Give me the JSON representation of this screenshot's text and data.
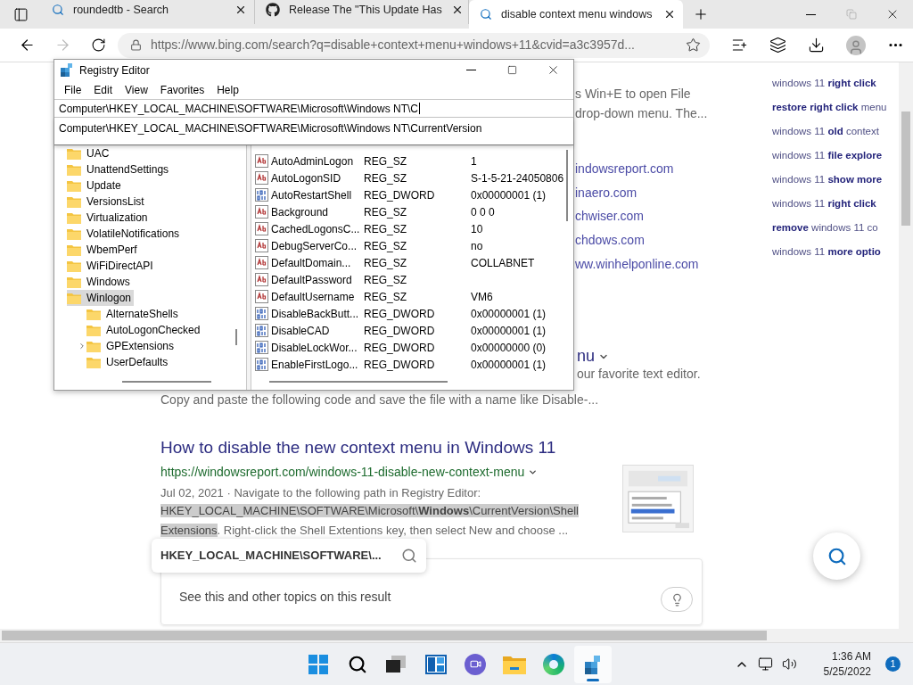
{
  "browser": {
    "tabs": [
      {
        "kind": "search",
        "title": "roundedtb - Search",
        "selected": false
      },
      {
        "kind": "github",
        "title": "Release The \"This Update Has",
        "selected": false
      },
      {
        "kind": "search",
        "title": "disable context menu windows",
        "selected": true
      }
    ],
    "address": "https://www.bing.com/search?q=disable+context+menu+windows+11&cvid=a3c3957d..."
  },
  "page": {
    "behind_window": {
      "snippet_lines": [
        "s Win+E to open File",
        "drop-down menu. The..."
      ],
      "sites": [
        "indowsreport.com",
        "inaero.com",
        "chwiser.com",
        "chdows.com",
        "ww.winhelponline.com"
      ],
      "title_end": "nu",
      "snippet_end": "our favorite text editor."
    },
    "copy_line": "Copy and paste the following code and save the file with a name like Disable-...",
    "result": {
      "title": "How to disable the new context menu in Windows 11",
      "url": "https://windowsreport.com/windows-11-disable-new-context-menu",
      "date": "Jul 02, 2021 · Navigate to the following path in Registry Editor:",
      "highlight_1": "HKEY_LOCAL_MACHINE\\SOFTWARE\\Microsoft\\**Windows**\\CurrentVersion\\Shell",
      "highlight_2": "Extensions",
      "rest": ". Right-click the Shell Extentions key, then select New and choose ..."
    },
    "floating_search": "HKEY_LOCAL_MACHINE\\SOFTWARE\\...",
    "topics": "See this and other topics on this result",
    "related": [
      "windows 11 **right click**",
      "**restore right click** menu",
      "windows 11 **old** context",
      "windows 11 **file explore**",
      "windows 11 **show more**",
      "windows 11 **right click**",
      "**remove** windows 11 co",
      "windows 11 **more optio**"
    ]
  },
  "registry": {
    "title": "Registry Editor",
    "menu": [
      "File",
      "Edit",
      "View",
      "Favorites",
      "Help"
    ],
    "address": "Computer\\HKEY_LOCAL_MACHINE\\SOFTWARE\\Microsoft\\Windows NT\\C",
    "suggestion": "Computer\\HKEY_LOCAL_MACHINE\\SOFTWARE\\Microsoft\\Windows NT\\CurrentVersion",
    "tree": [
      {
        "label": "UAC",
        "selected": false,
        "expandable": false
      },
      {
        "label": "UnattendSettings",
        "selected": false,
        "expandable": false
      },
      {
        "label": "Update",
        "selected": false,
        "expandable": false
      },
      {
        "label": "VersionsList",
        "selected": false,
        "expandable": false
      },
      {
        "label": "Virtualization",
        "selected": false,
        "expandable": false
      },
      {
        "label": "VolatileNotifications",
        "selected": false,
        "expandable": false
      },
      {
        "label": "WbemPerf",
        "selected": false,
        "expandable": false
      },
      {
        "label": "WiFiDirectAPI",
        "selected": false,
        "expandable": false
      },
      {
        "label": "Windows",
        "selected": false,
        "expandable": false
      },
      {
        "label": "Winlogon",
        "selected": true,
        "expandable": false,
        "children": [
          {
            "label": "AlternateShells",
            "selected": false,
            "expandable": false
          },
          {
            "label": "AutoLogonChecked",
            "selected": false,
            "expandable": false
          },
          {
            "label": "GPExtensions",
            "selected": false,
            "expandable": true
          },
          {
            "label": "UserDefaults",
            "selected": false,
            "expandable": false
          }
        ]
      }
    ],
    "values": [
      {
        "kind": "string",
        "name": "AutoAdminLogon",
        "type": "REG_SZ",
        "data": "1"
      },
      {
        "kind": "string",
        "name": "AutoLogonSID",
        "type": "REG_SZ",
        "data": "S-1-5-21-24050806"
      },
      {
        "kind": "binary",
        "name": "AutoRestartShell",
        "type": "REG_DWORD",
        "data": "0x00000001 (1)"
      },
      {
        "kind": "string",
        "name": "Background",
        "type": "REG_SZ",
        "data": "0 0 0"
      },
      {
        "kind": "string",
        "name": "CachedLogonsC...",
        "type": "REG_SZ",
        "data": "10"
      },
      {
        "kind": "string",
        "name": "DebugServerCo...",
        "type": "REG_SZ",
        "data": "no"
      },
      {
        "kind": "string",
        "name": "DefaultDomain...",
        "type": "REG_SZ",
        "data": "COLLABNET"
      },
      {
        "kind": "string",
        "name": "DefaultPassword",
        "type": "REG_SZ"
      },
      {
        "kind": "string",
        "name": "DefaultUsername",
        "type": "REG_SZ",
        "data": "VM6"
      },
      {
        "kind": "binary",
        "name": "DisableBackButt...",
        "type": "REG_DWORD",
        "data": "0x00000001 (1)"
      },
      {
        "kind": "binary",
        "name": "DisableCAD",
        "type": "REG_DWORD",
        "data": "0x00000001 (1)"
      },
      {
        "kind": "binary",
        "name": "DisableLockWor...",
        "type": "REG_DWORD",
        "data": "0x00000000 (0)"
      },
      {
        "kind": "binary",
        "name": "EnableFirstLogo...",
        "type": "REG_DWORD",
        "data": "0x00000001 (1)"
      }
    ]
  },
  "taskbar": {
    "apps": [
      {
        "kind": "start",
        "active": false
      },
      {
        "kind": "search",
        "active": false
      },
      {
        "kind": "taskview",
        "active": false
      },
      {
        "kind": "widgets",
        "active": false
      },
      {
        "kind": "chat",
        "active": false
      },
      {
        "kind": "explorer",
        "active": false
      },
      {
        "kind": "edge",
        "active": false
      },
      {
        "kind": "regedit",
        "active": true
      }
    ],
    "time": "1:36 AM",
    "date": "5/25/2022",
    "badge": "1"
  }
}
